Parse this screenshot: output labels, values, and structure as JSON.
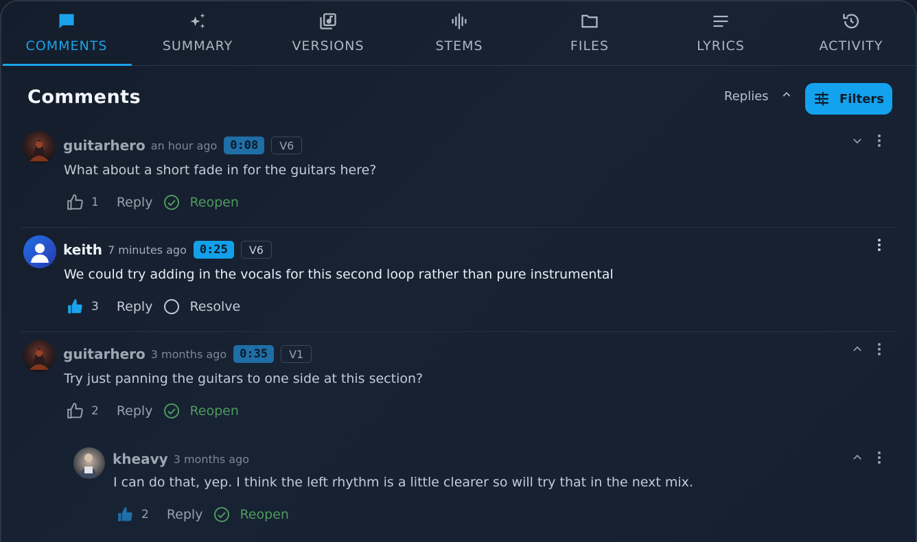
{
  "tabs": [
    {
      "label": "COMMENTS",
      "icon": "comment-icon",
      "active": true
    },
    {
      "label": "SUMMARY",
      "icon": "sparkle-icon"
    },
    {
      "label": "VERSIONS",
      "icon": "versions-icon"
    },
    {
      "label": "STEMS",
      "icon": "waveform-icon"
    },
    {
      "label": "FILES",
      "icon": "folder-icon"
    },
    {
      "label": "LYRICS",
      "icon": "lines-icon"
    },
    {
      "label": "ACTIVITY",
      "icon": "history-icon"
    }
  ],
  "header": {
    "title": "Comments",
    "replies_label": "Replies",
    "filters_label": "Filters"
  },
  "colors": {
    "accent": "#13a2ee",
    "resolved_green": "#4f9a5e"
  },
  "comments": [
    {
      "user": "guitarhero",
      "time": "an hour ago",
      "timestamp": "0:08",
      "version": "V6",
      "text": "What about a short fade in for the guitars here?",
      "likes": "1",
      "reply_label": "Reply",
      "status_label": "Reopen"
    },
    {
      "user": "keith",
      "time": "7 minutes ago",
      "timestamp": "0:25",
      "version": "V6",
      "text": "We could try adding in the vocals for this second loop rather than pure instrumental",
      "likes": "3",
      "reply_label": "Reply",
      "status_label": "Resolve"
    },
    {
      "user": "guitarhero",
      "time": "3 months ago",
      "timestamp": "0:35",
      "version": "V1",
      "text": "Try just panning the guitars to one side at this section?",
      "likes": "2",
      "reply_label": "Reply",
      "status_label": "Reopen"
    },
    {
      "user": "kheavy",
      "time": "3 months ago",
      "text": "I can do that, yep. I think the left rhythm is a little clearer so will try that in the next mix.",
      "likes": "2",
      "reply_label": "Reply",
      "status_label": "Reopen"
    }
  ]
}
